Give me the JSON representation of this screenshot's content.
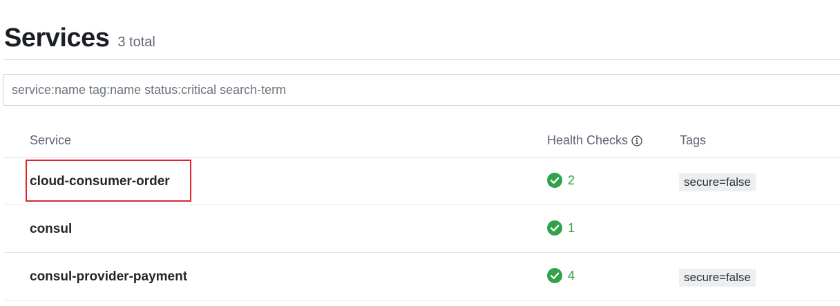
{
  "header": {
    "title": "Services",
    "count": "3 total"
  },
  "search": {
    "placeholder": "service:name tag:name status:critical search-term"
  },
  "table": {
    "columns": {
      "service": "Service",
      "health": "Health Checks",
      "tags": "Tags"
    },
    "rows": [
      {
        "name": "cloud-consumer-order",
        "health_count": "2",
        "health_status": "passing",
        "tag": "secure=false",
        "highlighted": true
      },
      {
        "name": "consul",
        "health_count": "1",
        "health_status": "passing",
        "tag": "",
        "highlighted": false
      },
      {
        "name": "consul-provider-payment",
        "health_count": "4",
        "health_status": "passing",
        "tag": "secure=false",
        "highlighted": false
      }
    ]
  },
  "colors": {
    "passing": "#2fa24a",
    "highlight": "#e0252b"
  },
  "icons": {
    "health_header": "info-circle-icon",
    "health_status": "check-circle-icon"
  }
}
